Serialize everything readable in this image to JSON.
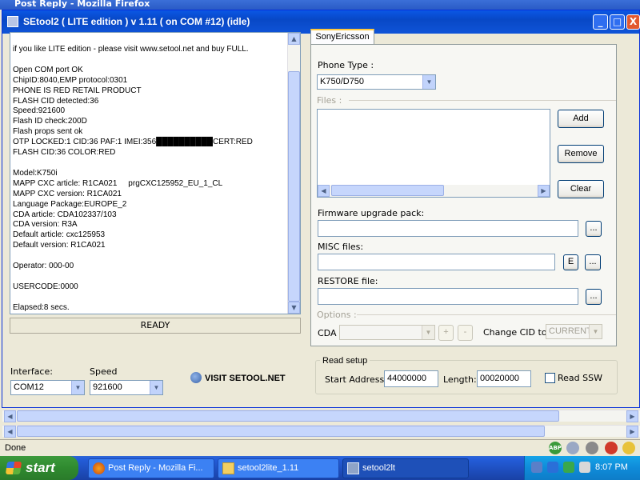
{
  "background_window": {
    "title": "Post Reply - Mozilla Firefox"
  },
  "window": {
    "title": "SEtool2 ( LITE edition ) v 1.11 ( on COM #12) (idle)",
    "minimize": "_",
    "maximize": "□",
    "close": "X"
  },
  "log": {
    "text": "if you like LITE edition - please visit www.setool.net and buy FULL.\n\nOpen COM port OK\nChipID:8040,EMP protocol:0301\nPHONE IS RED RETAIL PRODUCT\nFLASH CID detected:36\nSpeed:921600\nFlash ID check:200D\nFlash props sent ok\nOTP LOCKED:1 CID:36 PAF:1 IMEI:356██████████CERT:RED\nFLASH CID:36 COLOR:RED\n\nModel:K750i\nMAPP CXC article: R1CA021     prgCXC125952_EU_1_CL\nMAPP CXC version: R1CA021\nLanguage Package:EUROPE_2\nCDA article: CDA102337/103\nCDA version: R3A\nDefault article: cxc125953\nDefault version: R1CA021\n\nOperator: 000-00\n\nUSERCODE:0000\n\nElapsed:8 secs."
  },
  "status": "READY",
  "interface": {
    "label": "Interface:",
    "value": "COM12"
  },
  "speed": {
    "label": "Speed",
    "value": "921600"
  },
  "visit_label": "VISIT SETOOL.NET",
  "tab_label": "SonyEricsson",
  "phone_type": {
    "label": "Phone Type :",
    "value": "K750/D750"
  },
  "files": {
    "label": "Files :",
    "add": "Add",
    "remove": "Remove",
    "clear": "Clear"
  },
  "firmware_label": "Firmware upgrade pack:",
  "misc_label": "MISC files:",
  "misc_e": "E",
  "restore_label": "RESTORE file:",
  "browse_label": "...",
  "options": {
    "label": "Options :",
    "cda_label": "CDA",
    "plus": "+",
    "minus": "-",
    "change_cid_label": "Change CID to",
    "change_cid_value": "CURRENT"
  },
  "read_setup": {
    "legend": "Read setup",
    "start_label": "Start Address:",
    "start_value": "44000000",
    "length_label": "Length:",
    "length_value": "00020000",
    "ssw_label": "Read SSW"
  },
  "statusbar": {
    "text": "Done",
    "abp": "ABP"
  },
  "taskbar": {
    "start": "start",
    "tasks": [
      "Post Reply - Mozilla Fi...",
      "setool2lite_1.11",
      "setool2lt"
    ],
    "clock": "8:07 PM"
  },
  "colors": {
    "titlebar": "#0a57e5",
    "taskbar": "#245edb",
    "start": "#3c9a3c",
    "tray": "#0f8bd9"
  }
}
